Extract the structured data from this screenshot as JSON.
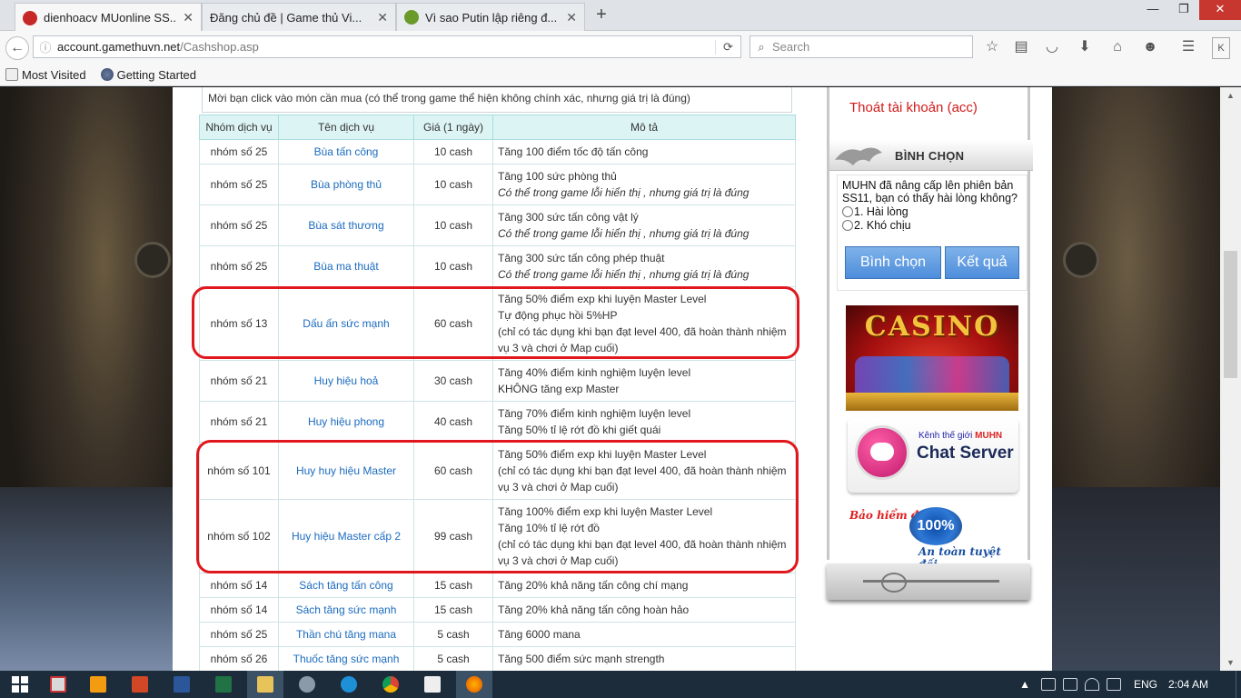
{
  "browser": {
    "tabs": [
      {
        "title": "dienhoacv MUonline SS...",
        "favicon_color": "#c62828",
        "active": true
      },
      {
        "title": "Đăng chủ đề | Game thủ Vi...",
        "favicon_color": "",
        "active": false
      },
      {
        "title": "Vì sao Putin lập riêng đ...",
        "favicon_color": "#6a9a2a",
        "active": false
      }
    ],
    "new_tab": "+",
    "window_controls": {
      "minimize": "—",
      "restore": "❐",
      "close": "✕"
    },
    "url_domain": "account.gamethuvn.net",
    "url_path": "/Cashshop.asp",
    "search_placeholder": "Search",
    "bookmarks": [
      {
        "label": "Most Visited"
      },
      {
        "label": "Getting Started"
      }
    ]
  },
  "page": {
    "notice": "Mời bạn click vào món cần mua (có thể trong game thể hiện không chính xác, nhưng giá trị là đúng)",
    "table": {
      "headers": [
        "Nhóm dịch vụ",
        "Tên dịch vụ",
        "Giá (1 ngày)",
        "Mô tả"
      ],
      "rows": [
        {
          "group": "nhóm số 25",
          "name": "Bùa tấn công",
          "price": "10 cash",
          "desc": [
            "Tăng 100 điểm tốc độ tấn công"
          ],
          "note": ""
        },
        {
          "group": "nhóm số 25",
          "name": "Bùa phòng thủ",
          "price": "10 cash",
          "desc": [
            "Tăng 100 sức phòng thủ"
          ],
          "note": "Có thể trong game lỗi hiển thị , nhưng giá trị là đúng"
        },
        {
          "group": "nhóm số 25",
          "name": "Bùa sát thương",
          "price": "10 cash",
          "desc": [
            "Tăng 300 sức tấn công vật lý"
          ],
          "note": "Có thể trong game lỗi hiển thị , nhưng giá trị là đúng"
        },
        {
          "group": "nhóm số 25",
          "name": "Bùa ma thuật",
          "price": "10 cash",
          "desc": [
            "Tăng 300 sức tấn công phép thuật"
          ],
          "note": "Có thể trong game lỗi hiển thị , nhưng giá trị là đúng"
        },
        {
          "group": "nhóm số 13",
          "name": "Dấu ấn sức mạnh",
          "price": "60 cash",
          "desc": [
            "Tăng 50% điểm exp khi luyện Master Level",
            "Tự động phục hồi 5%HP",
            "(chỉ có tác dụng khi bạn đạt level 400, đã hoàn thành nhiệm vụ 3 và chơi ở Map cuối)"
          ],
          "note": ""
        },
        {
          "group": "nhóm số 21",
          "name": "Huy hiệu hoả",
          "price": "30 cash",
          "desc": [
            "Tăng 40% điểm kinh nghiệm luyện level",
            "KHÔNG tăng exp Master"
          ],
          "note": ""
        },
        {
          "group": "nhóm số 21",
          "name": "Huy hiệu phong",
          "price": "40 cash",
          "desc": [
            "Tăng 70% điểm kinh nghiệm luyện level",
            "Tăng 50% tỉ lệ rớt đồ khi giết quái"
          ],
          "note": ""
        },
        {
          "group": "nhóm số 101",
          "name": "Huy huy hiệu Master",
          "price": "60 cash",
          "desc": [
            "Tăng 50% điểm exp khi luyện Master Level",
            "(chỉ có tác dụng khi bạn đạt level 400, đã hoàn thành nhiệm vụ 3 và chơi ở Map cuối)"
          ],
          "note": ""
        },
        {
          "group": "nhóm số 102",
          "name": "Huy hiệu Master cấp 2",
          "price": "99 cash",
          "desc": [
            "Tăng 100% điểm exp khi luyện Master Level",
            "Tăng 10% tỉ lệ rớt đồ",
            "(chỉ có tác dụng khi bạn đạt level 400, đã hoàn thành nhiệm vụ 3 và chơi ở Map cuối)"
          ],
          "note": ""
        },
        {
          "group": "nhóm số 14",
          "name": "Sách tăng tấn công",
          "price": "15 cash",
          "desc": [
            "Tăng 20% khả năng tấn công chí mạng"
          ],
          "note": ""
        },
        {
          "group": "nhóm số 14",
          "name": "Sách tăng sức mạnh",
          "price": "15 cash",
          "desc": [
            "Tăng 20% khả năng tấn công hoàn hảo"
          ],
          "note": ""
        },
        {
          "group": "nhóm số 25",
          "name": "Thần chú tăng mana",
          "price": "5 cash",
          "desc": [
            "Tăng 6000 mana"
          ],
          "note": ""
        },
        {
          "group": "nhóm số 26",
          "name": "Thuốc tăng sức mạnh",
          "price": "5 cash",
          "desc": [
            "Tăng 500 điểm sức mạnh strength"
          ],
          "note": ""
        }
      ]
    },
    "highlight_color": "#e0181e"
  },
  "sidebar": {
    "logout": "Thoát tài khoản (acc)",
    "vote_title": "BÌNH CHỌN",
    "vote_question": "MUHN đã nâng cấp lên phiên bản SS11, bạn có thấy hài lòng không?",
    "vote_options": [
      "1. Hài lòng",
      "2. Khó chịu"
    ],
    "vote_button": "Bình chọn",
    "result_button": "Kết quả",
    "casino_label": "CASINO",
    "chat_kicker": "Kênh thế giới",
    "chat_kicker_brand": "MUHN",
    "chat_label": "Chat Server",
    "insurance_label": "Bảo hiểm đồ",
    "insurance_seal": "100%",
    "insurance_safe": "An toàn tuyệt đối"
  },
  "taskbar": {
    "language": "ENG",
    "time": "2:04 AM"
  }
}
